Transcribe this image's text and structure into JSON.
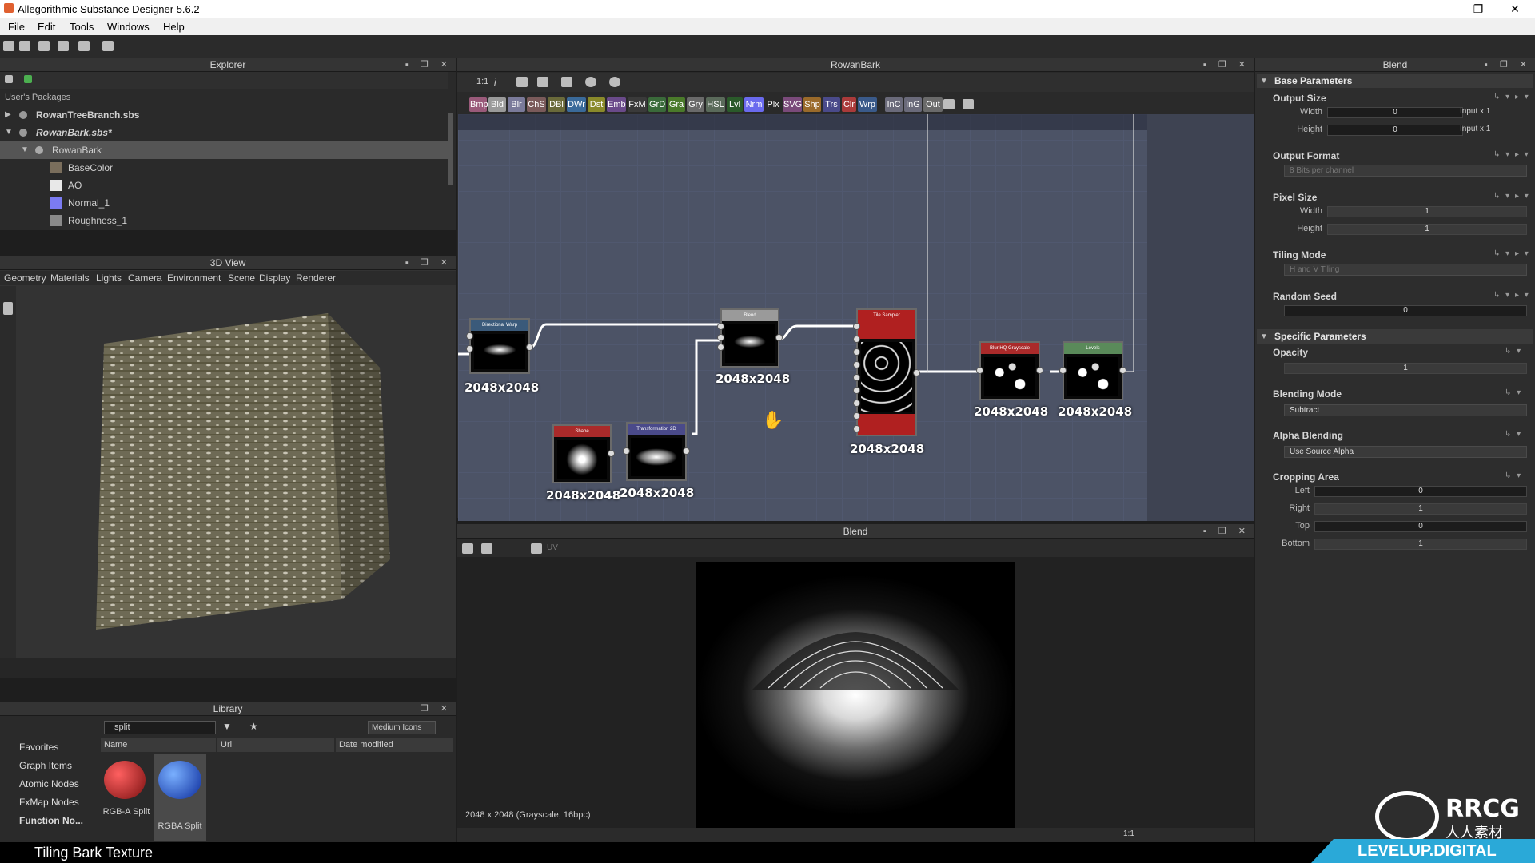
{
  "window": {
    "title": "Allegorithmic Substance Designer 5.6.2",
    "min": "—",
    "max": "❐",
    "close": "✕"
  },
  "menu": [
    "File",
    "Edit",
    "Tools",
    "Windows",
    "Help"
  ],
  "explorer": {
    "title": "Explorer",
    "section": "User's Packages",
    "items": [
      {
        "label": "RowanTreeBranch.sbs",
        "swatch": ""
      },
      {
        "label": "RowanBark.sbs*",
        "swatch": ""
      },
      {
        "label": "RowanBark",
        "swatch": ""
      },
      {
        "label": "BaseColor",
        "swatch": "#7a6e5c"
      },
      {
        "label": "AO",
        "swatch": "#e8e8e8"
      },
      {
        "label": "Normal_1",
        "swatch": "#7b7bf2"
      },
      {
        "label": "Roughness_1",
        "swatch": "#8a8a8a"
      }
    ]
  },
  "view3d": {
    "title": "3D View",
    "menu": [
      "Geometry",
      "Materials",
      "Lights",
      "Camera",
      "Environment",
      "Scene",
      "Display",
      "Renderer"
    ]
  },
  "library": {
    "title": "Library",
    "search": "split",
    "view_mode": "Medium Icons",
    "categories": [
      "Favorites",
      "Graph Items",
      "Atomic Nodes",
      "FxMap Nodes",
      "Function No..."
    ],
    "columns": [
      "Name",
      "Url",
      "Date modified"
    ],
    "results": [
      {
        "label": "RGB-A Split"
      },
      {
        "label": "RGBA Split"
      }
    ]
  },
  "graph": {
    "title": "RowanBark",
    "zoom": "1:1",
    "info": "i",
    "chips": [
      {
        "label": "Bmp",
        "color": "#9a5a7a"
      },
      {
        "label": "Bld",
        "color": "#9a9a9a"
      },
      {
        "label": "Blr",
        "color": "#7a7a9a"
      },
      {
        "label": "ChS",
        "color": "#7a5a5a"
      },
      {
        "label": "DBl",
        "color": "#6a6a3a"
      },
      {
        "label": "DWr",
        "color": "#3a6a9a"
      },
      {
        "label": "Dst",
        "color": "#8a8a2a"
      },
      {
        "label": "Emb",
        "color": "#6a4a8a"
      },
      {
        "label": "FxM",
        "color": "#3a3a3a"
      },
      {
        "label": "GrD",
        "color": "#3a6a3a"
      },
      {
        "label": "Gra",
        "color": "#4a7a2a"
      },
      {
        "label": "Gry",
        "color": "#6a6a6a"
      },
      {
        "label": "HSL",
        "color": "#5a6a5a"
      },
      {
        "label": "Lvl",
        "color": "#2a5a2a"
      },
      {
        "label": "Nrm",
        "color": "#6a6aee"
      },
      {
        "label": "Plx",
        "color": "#2a2a2a"
      },
      {
        "label": "SVG",
        "color": "#7a4a7a"
      },
      {
        "label": "Shp",
        "color": "#9a6a2a"
      },
      {
        "label": "Trs",
        "color": "#4a4a8a"
      },
      {
        "label": "Clr",
        "color": "#aa3a3a"
      },
      {
        "label": "Wrp",
        "color": "#3a5a8a"
      },
      {
        "label": "InC",
        "color": "#6a6a7a"
      },
      {
        "label": "InG",
        "color": "#6a6a7a"
      },
      {
        "label": "Out",
        "color": "#6a6a6a"
      }
    ],
    "nodes": [
      {
        "name": "Directional Warp",
        "res": "2048x2048",
        "color": "#3a5a7a"
      },
      {
        "name": "Blend",
        "res": "2048x2048",
        "color": "#9a9a9a"
      },
      {
        "name": "Shape",
        "res": "2048x2048",
        "color": "#aa2a2a"
      },
      {
        "name": "Transformation 2D",
        "res": "2048x2048",
        "color": "#4a4a8a"
      },
      {
        "name": "Tile Sampler",
        "res": "2048x2048",
        "color": "#b02020"
      },
      {
        "name": "Blur HQ Grayscale",
        "res": "2048x2048",
        "color": "#aa2a2a"
      },
      {
        "name": "Levels",
        "res": "2048x2048",
        "color": "#5a8a5a"
      }
    ]
  },
  "view2d": {
    "title": "Blend",
    "status": "2048 x 2048 (Grayscale, 16bpc)",
    "zoom": "1:1",
    "uv": "UV"
  },
  "props": {
    "title": "Blend",
    "base": "Base Parameters",
    "output_size": {
      "label": "Output Size",
      "width_label": "Width",
      "width": "0",
      "width_suffix": "Input x 1",
      "height_label": "Height",
      "height": "0",
      "height_suffix": "Input x 1"
    },
    "output_format": {
      "label": "Output Format",
      "value": "8 Bits per channel"
    },
    "pixel_size": {
      "label": "Pixel Size",
      "width_label": "Width",
      "width": "1",
      "height_label": "Height",
      "height": "1"
    },
    "tiling": {
      "label": "Tiling Mode",
      "value": "H and V Tiling"
    },
    "seed": {
      "label": "Random Seed",
      "value": "0"
    },
    "specific": "Specific Parameters",
    "opacity": {
      "label": "Opacity",
      "value": "1"
    },
    "blend_mode": {
      "label": "Blending Mode",
      "value": "Subtract"
    },
    "alpha": {
      "label": "Alpha Blending",
      "value": "Use Source Alpha"
    },
    "crop": {
      "label": "Cropping Area",
      "left_label": "Left",
      "left": "0",
      "right_label": "Right",
      "right": "1",
      "top_label": "Top",
      "top": "0",
      "bottom_label": "Bottom",
      "bottom": "1"
    }
  },
  "caption": "Tiling Bark Texture",
  "watermark": {
    "brand": "RRCG",
    "cn": "人人素材",
    "site": "LEVELUP.DIGITAL"
  }
}
